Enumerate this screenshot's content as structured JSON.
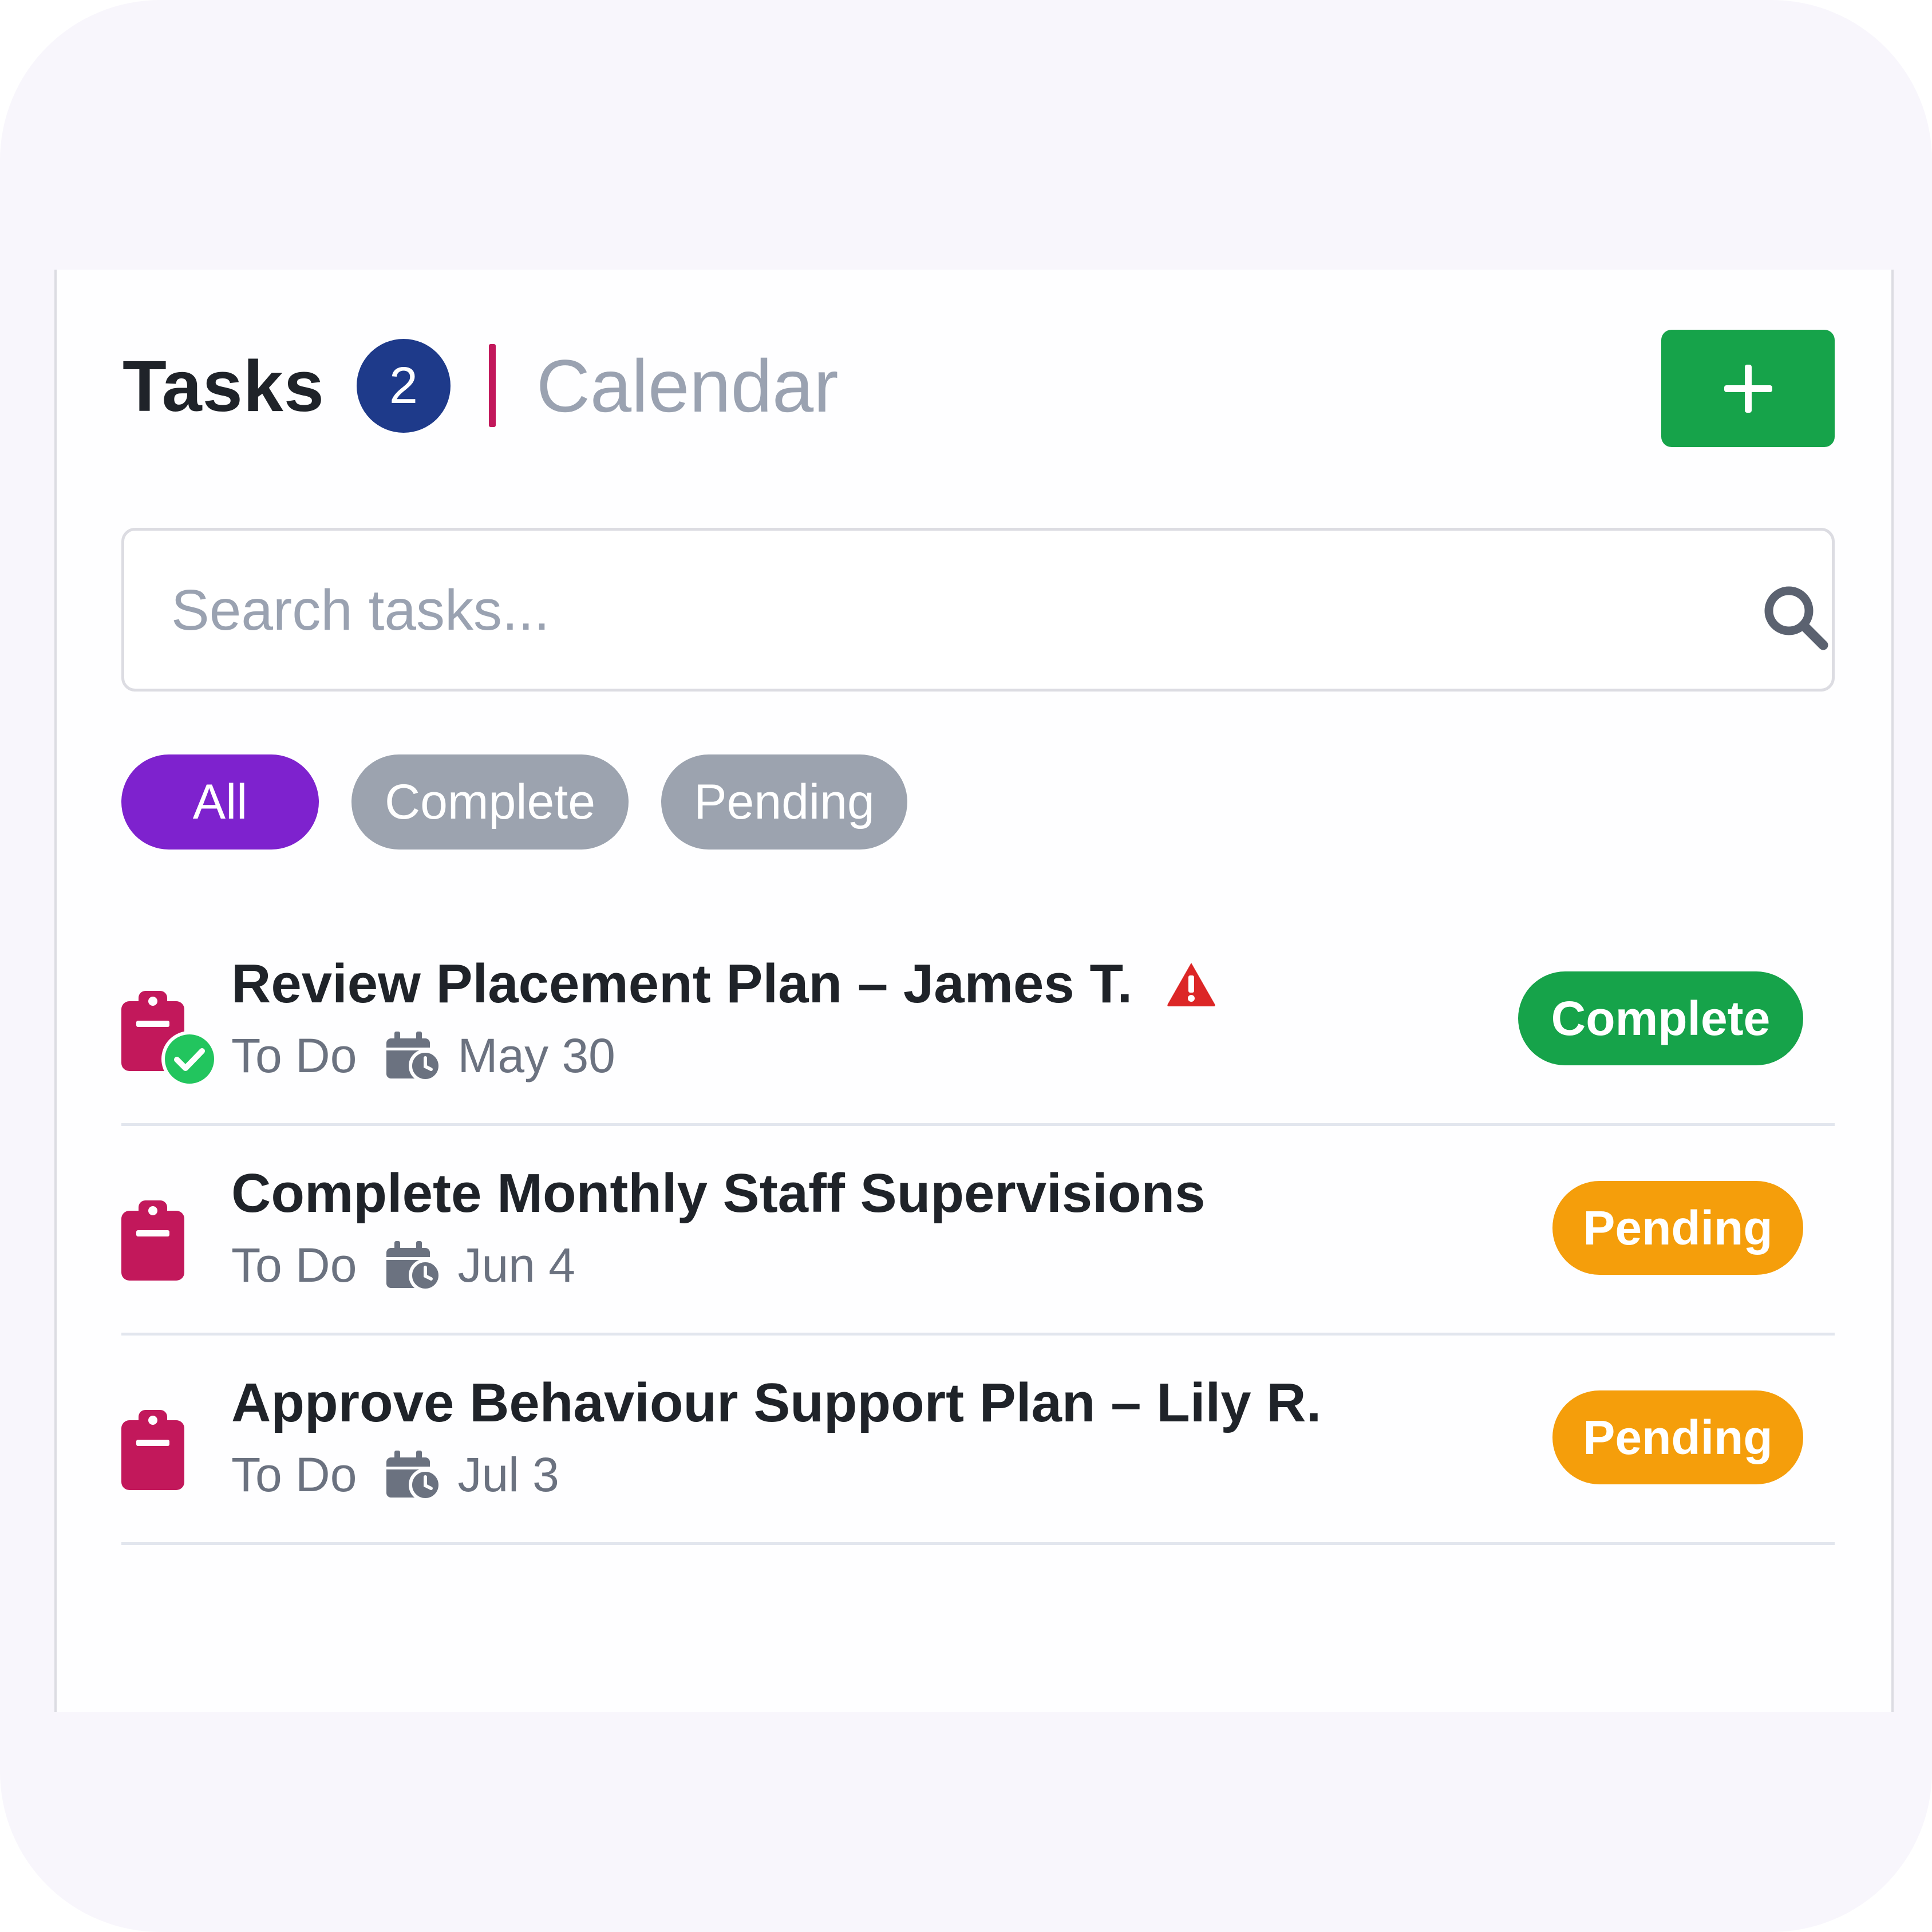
{
  "header": {
    "tasks_tab_label": "Tasks",
    "tasks_count": "2",
    "calendar_tab_label": "Calendar",
    "add_button_label": "+"
  },
  "search": {
    "placeholder": "Search tasks..."
  },
  "filters": [
    {
      "label": "All",
      "active": true
    },
    {
      "label": "Complete",
      "active": false
    },
    {
      "label": "Pending",
      "active": false
    }
  ],
  "tasks": [
    {
      "title": "Review Placement Plan – James T.",
      "category": "To Do",
      "date": "May 30",
      "status": "Complete",
      "flagged": true,
      "done_check": true
    },
    {
      "title": "Complete Monthly Staff Supervisions",
      "category": "To Do",
      "date": "Jun 4",
      "status": "Pending",
      "flagged": false,
      "done_check": false
    },
    {
      "title": "Approve Behaviour Support Plan – Lily R.",
      "category": "To Do",
      "date": "Jul 3",
      "status": "Pending",
      "flagged": false,
      "done_check": false
    }
  ],
  "colors": {
    "accent_purple": "#7e22ce",
    "success_green": "#16a34a",
    "pending_amber": "#f59e0b",
    "badge_navy": "#1e3a8a",
    "clipboard_magenta": "#c2185b",
    "warning_red": "#dc2626"
  },
  "icons": {
    "add": "plus-icon",
    "search": "search-icon",
    "task": "clipboard-icon",
    "done": "check-circle-icon",
    "warning": "warning-icon",
    "date": "calendar-clock-icon"
  }
}
